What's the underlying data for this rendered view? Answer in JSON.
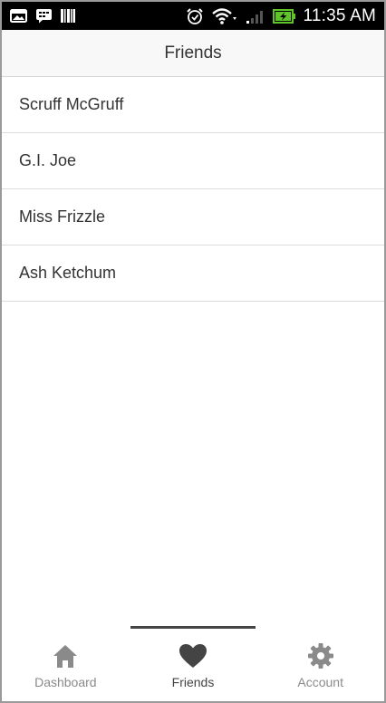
{
  "status_bar": {
    "time": "11:35 AM",
    "left_icons": [
      "gallery-icon",
      "bbm-icon",
      "barcode-icon"
    ],
    "right_icons": [
      "alarm-icon",
      "wifi-icon",
      "signal-icon",
      "battery-charging-icon"
    ]
  },
  "header": {
    "title": "Friends"
  },
  "friends": [
    {
      "name": "Scruff McGruff"
    },
    {
      "name": "G.I. Joe"
    },
    {
      "name": "Miss Frizzle"
    },
    {
      "name": "Ash Ketchum"
    }
  ],
  "tabs": [
    {
      "label": "Dashboard",
      "icon": "home-icon",
      "active": false
    },
    {
      "label": "Friends",
      "icon": "heart-icon",
      "active": true
    },
    {
      "label": "Account",
      "icon": "gear-icon",
      "active": false
    }
  ],
  "colors": {
    "status_bar": "#000000",
    "header_bg": "#f8f8f8",
    "active_icon": "#444444",
    "inactive_icon": "#8a8a8a",
    "battery": "#5ec42a"
  }
}
